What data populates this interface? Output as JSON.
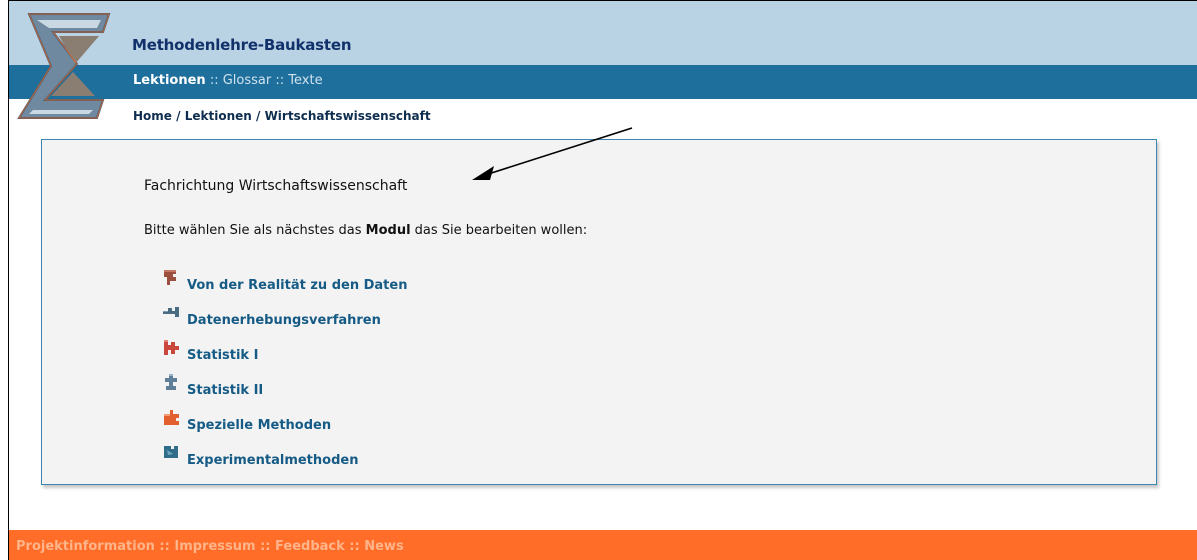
{
  "app": {
    "title": "Methodenlehre-Baukasten"
  },
  "nav": {
    "items": [
      {
        "label": "Lektionen"
      },
      {
        "label": "Glossar"
      },
      {
        "label": "Texte"
      }
    ],
    "separator": "::"
  },
  "breadcrumb": {
    "parts": [
      "Home",
      "Lektionen",
      "Wirtschaftswissenschaft"
    ],
    "separator": "/"
  },
  "main": {
    "heading": "Fachrichtung Wirtschaftswissenschaft",
    "intro_before": "Bitte wählen Sie als nächstes das ",
    "intro_bold": "Modul",
    "intro_after": " das Sie bearbeiten wollen:",
    "modules": [
      {
        "label": "Von der Realität zu den Daten",
        "icon": "puzzle-brown-icon",
        "color": "#9c4f3e"
      },
      {
        "label": "Datenerhebungsverfahren",
        "icon": "puzzle-slate-icon",
        "color": "#4a6b80"
      },
      {
        "label": "Statistik I",
        "icon": "puzzle-red-icon",
        "color": "#c9473b"
      },
      {
        "label": "Statistik II",
        "icon": "puzzle-steel-icon",
        "color": "#5f7f99"
      },
      {
        "label": "Spezielle Methoden",
        "icon": "puzzle-orange-icon",
        "color": "#e2602f"
      },
      {
        "label": "Experimentalmethoden",
        "icon": "puzzle-teal-icon",
        "color": "#2f6d8a"
      }
    ]
  },
  "footer": {
    "links": [
      "Projektinformation",
      "Impressum",
      "Feedback",
      "News"
    ],
    "separator": "::"
  },
  "colors": {
    "header_band": "#b9d3e5",
    "nav_band": "#1f6f9c",
    "footer_band": "#ff6d28",
    "link": "#155b86"
  }
}
